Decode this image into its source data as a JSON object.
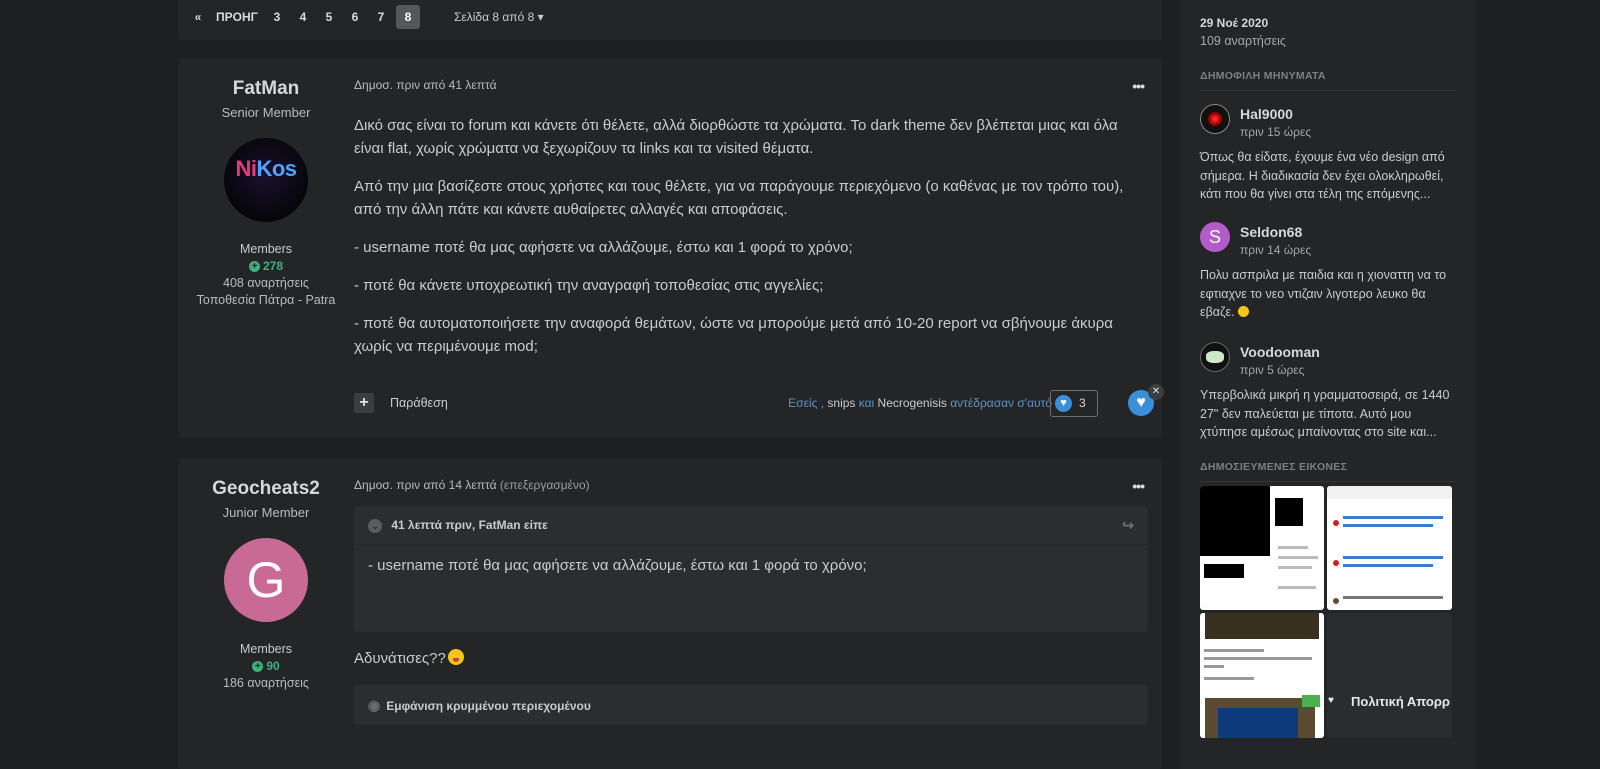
{
  "pagination": {
    "prev_icon": "«",
    "prev_label": "ΠΡΟΗΓ",
    "pages": [
      "3",
      "4",
      "5",
      "6",
      "7",
      "8"
    ],
    "current": "8",
    "page_jump": "Σελίδα 8 από 8",
    "page_jump_icon": "▾"
  },
  "posts": [
    {
      "author": "FatMan",
      "title": "Senior Member",
      "avatar_text_a": "Ni",
      "avatar_text_b": "Kos",
      "group": "Members",
      "reputation": "278",
      "posts_count": "408 αναρτήσεις",
      "location": "Τοποθεσία Πάτρα - Patra",
      "meta": "Δημοσ. πριν από 41 λεπτά",
      "menu": "•••",
      "paragraphs": [
        "Δικό σας είναι το forum και κάνετε ότι θέλετε, αλλά διορθώστε τα χρώματα. Το dark theme δεν βλέπεται μιας και όλα είναι flat, χωρίς χρώματα να ξεχωρίζουν τα links και τα visited θέματα.",
        "Από την μια βασίζεστε στους χρήστες και τους θέλετε, για να παράγουμε περιεχόμενο (ο καθένας με τον τρόπο του), από την άλλη πάτε και κάνετε αυθαίρετες αλλαγές και αποφάσεις.",
        "- username ποτέ θα μας αφήσετε να αλλάζουμε, έστω και 1 φορά το χρόνο;",
        "- ποτέ θα κάνετε υποχρεωτική την αναγραφή τοποθεσίας στις αγγελίες;",
        "- ποτέ θα αυτοματοποιήσετε την αναφορά θεμάτων, ώστε να μπορούμε μετά από 10-20 report να σβήνουμε άκυρα χωρίς να περιμένουμε mod;"
      ],
      "quote_button": "Παράθεση",
      "reacted_a": "Εσείς",
      "reacted_sep1": " , ",
      "reacted_b": "snips",
      "reacted_and": " και ",
      "reacted_c": "Necrogenisis",
      "reacted_suffix": " αντέδρασαν σ'αυτό",
      "reaction_count": "3"
    },
    {
      "author": "Geocheats2",
      "title": "Junior Member",
      "avatar_letter": "G",
      "group": "Members",
      "reputation": "90",
      "posts_count": "186 αναρτήσεις",
      "meta": "Δημοσ. πριν από 14 λεπτά",
      "edited": "(επεξεργασμένο)",
      "menu": "•••",
      "quote_header": "41 λεπτά πριν, FatMan είπε",
      "quote_text": "- username ποτέ θα μας αφήσετε να αλλάζουμε, έστω και 1 φορά το χρόνο;",
      "reply_text": "Αδυνάτισες??",
      "spoiler": "Εμφάνιση κρυμμένου περιεχομένου"
    }
  ],
  "sidebar": {
    "date": "29 Νοέ 2020",
    "count": "109 αναρτήσεις",
    "popular_heading": "ΔΗΜΟΦΙΛΗ ΜΗΝΥΜΑΤΑ",
    "popular": [
      {
        "name": "Hal9000",
        "time": "πριν 15 ώρες",
        "text": "Όπως θα είδατε, έχουμε ένα νέο design από σήμερα. Η διαδικασία δεν έχει ολοκληρωθεί, κάτι που θα γίνει στα τέλη της επόμενης..."
      },
      {
        "name": "Seldon68",
        "avatar_letter": "S",
        "time": "πριν 14 ώρες",
        "text": "Πολυ ασπριλα με παιδια και η χιοναττη να το εφτιαχνε το νεο ντιζαιν λιγοτερο λευκο θα εβαζε."
      },
      {
        "name": "Voodooman",
        "time": "πριν 5 ώρες",
        "text": "Υπερβολικά μικρή η γραμματοσειρά, σε 1440 27\" δεν παλεύεται με τίποτα. Αυτό μου χτύπησε αμέσως μπαίνοντας στο site και..."
      }
    ],
    "images_heading": "ΔΗΜΟΣΙΕΥΜΕΝΕΣ ΕΙΚΟΝΕΣ",
    "gallery_label": "Πολιτική Απορρ"
  },
  "colors": {
    "background": "#1d1f21",
    "panel": "#232527",
    "accent_link": "#5e94c4",
    "reputation_green": "#3bb37a",
    "like_blue": "#3b8ed8"
  },
  "icons": [
    "double-chevron-left-icon",
    "caret-down-icon",
    "ellipsis-icon",
    "plus-icon",
    "heart-icon",
    "close-icon",
    "chevron-down-icon",
    "share-icon",
    "eye-icon",
    "grin-emoji-icon",
    "flushed-emoji-icon"
  ]
}
